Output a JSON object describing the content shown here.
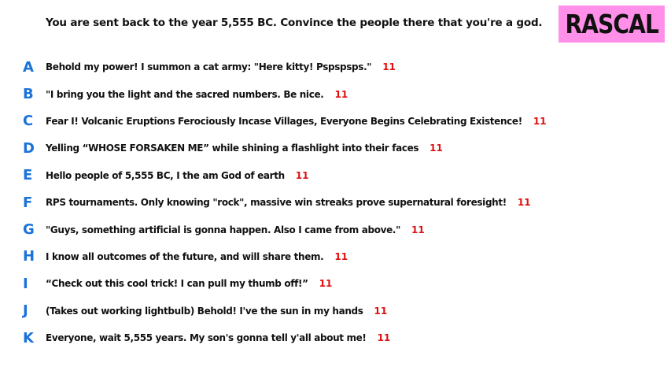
{
  "prompt": "You are sent back to the year 5,555 BC. Convince the people there that you're a god.",
  "logo": "RASCAL",
  "colors": {
    "letter": "#1a73d9",
    "score": "#e01010",
    "logo_background": "#ff8fe9"
  },
  "answers": [
    {
      "letter": "A",
      "text": "Behold my power! I summon a cat army: \"Here kitty! Pspspsps.\"",
      "score": "11"
    },
    {
      "letter": "B",
      "text": "\"I bring you the light and the sacred numbers. Be nice.",
      "score": "11"
    },
    {
      "letter": "C",
      "text": "Fear I! Volcanic Eruptions Ferociously Incase Villages, Everyone Begins Celebrating Existence!",
      "score": "11"
    },
    {
      "letter": "D",
      "text": "Yelling “WHOSE FORSAKEN ME” while shining a flashlight into their faces",
      "score": "11"
    },
    {
      "letter": "E",
      "text": "Hello people of 5,555 BC, I the am God of earth",
      "score": "11"
    },
    {
      "letter": "F",
      "text": "RPS tournaments. Only knowing \"rock\", massive win streaks prove supernatural foresight!",
      "score": "11"
    },
    {
      "letter": "G",
      "text": "\"Guys, something artificial is gonna happen. Also I came from above.\"",
      "score": "11"
    },
    {
      "letter": "H",
      "text": "I know all outcomes of the future, and will share them.",
      "score": "11"
    },
    {
      "letter": "I",
      "text": "“Check out this cool trick! I can pull my thumb off!”",
      "score": "11"
    },
    {
      "letter": "J",
      "text": "(Takes out working lightbulb) Behold! I've the sun in my hands",
      "score": "11"
    },
    {
      "letter": "K",
      "text": "Everyone, wait 5,555 years. My son's gonna tell y'all about me!",
      "score": "11"
    }
  ]
}
